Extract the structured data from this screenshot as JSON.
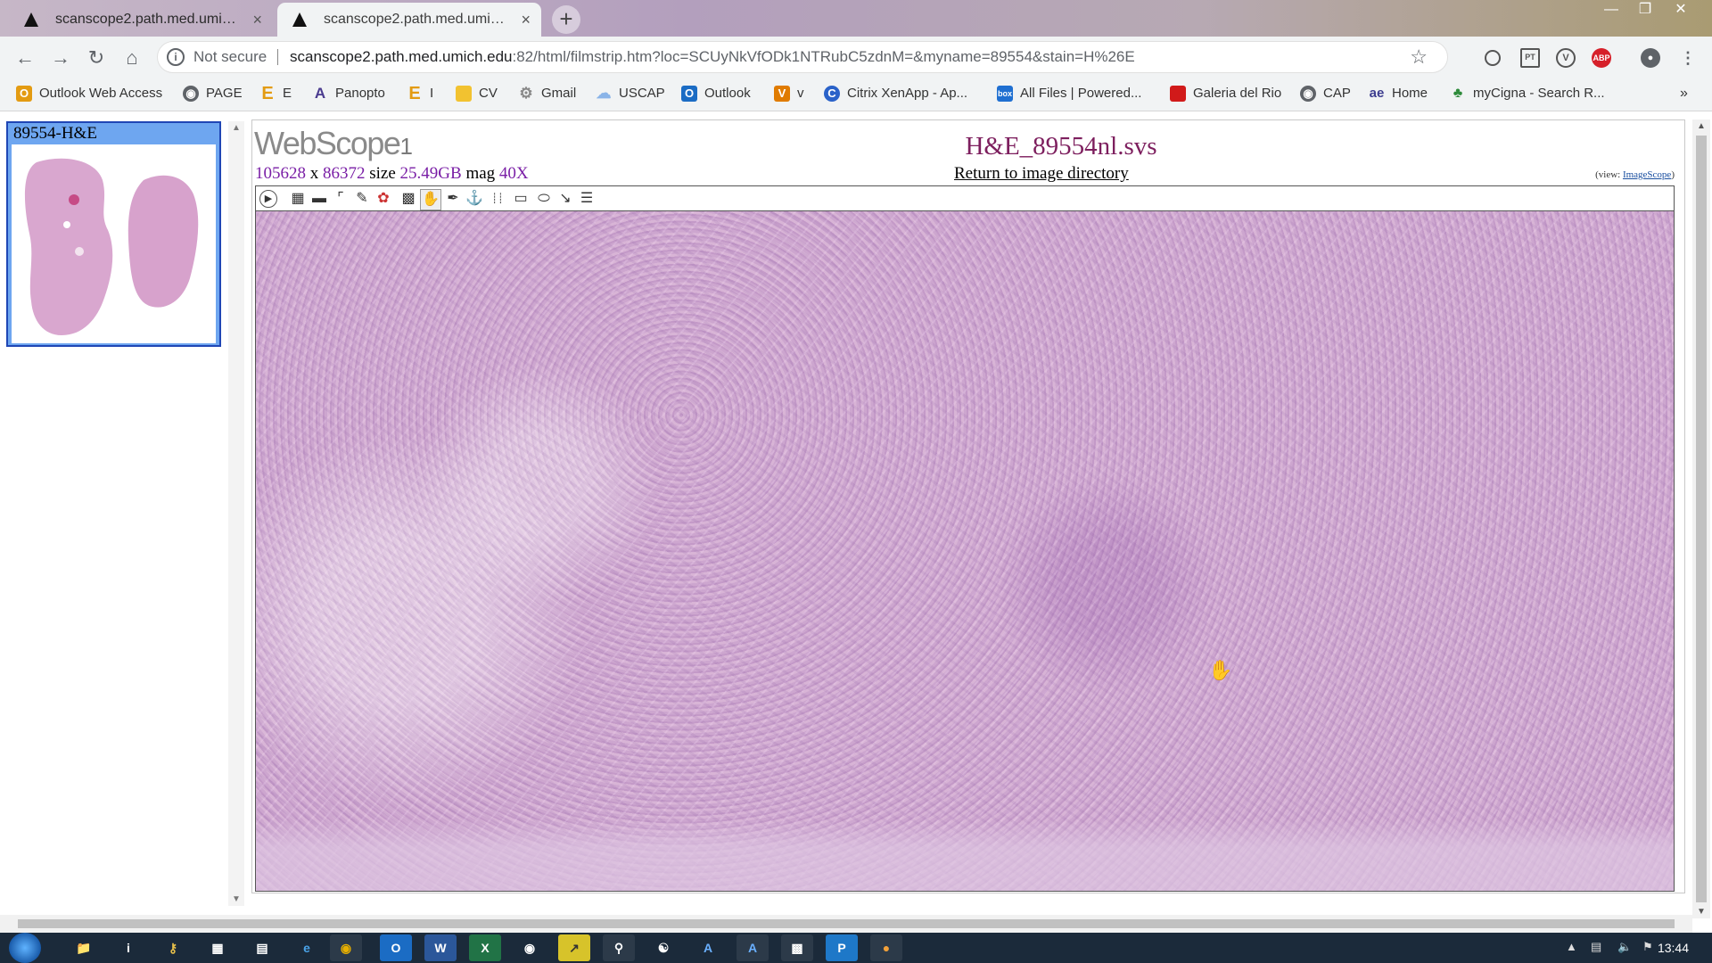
{
  "browser": {
    "tabs": [
      {
        "label": "scanscope2.path.med.umich.edu",
        "active": false
      },
      {
        "label": "scanscope2.path.med.umich.edu",
        "active": true
      }
    ],
    "new_tab": "+",
    "close_glyph": "×",
    "omnibox": {
      "security": "Not secure",
      "url_host": "scanscope2.path.med.umich.edu",
      "url_rest": ":82/html/filmstrip.htm?loc=SCUyNkVfODk1NTRubC5zdnM=&myname=89554&stain=H%26E"
    },
    "bookmarks": [
      {
        "label": "Outlook Web Access",
        "icon": "outlook-icon",
        "color": "#e39b12"
      },
      {
        "label": "PAGE",
        "icon": "globe-icon",
        "color": "#5f6368"
      },
      {
        "label": "E",
        "icon": "e-icon",
        "color": "#e39b12"
      },
      {
        "label": "Panopto",
        "icon": "panopto-icon",
        "color": "#4a3b8f"
      },
      {
        "label": "I",
        "icon": "e-icon",
        "color": "#e39b12"
      },
      {
        "label": "CV",
        "icon": "folder-icon",
        "color": "#f2c230"
      },
      {
        "label": "Gmail",
        "icon": "gear-icon",
        "color": "#888"
      },
      {
        "label": "USCAP",
        "icon": "cloud-icon",
        "color": "#8ab4e8"
      },
      {
        "label": "Outlook",
        "icon": "outlook-icon",
        "color": "#1b6cc4"
      },
      {
        "label": "v",
        "icon": "v-icon",
        "color": "#e07b00"
      },
      {
        "label": "Citrix XenApp - Ap...",
        "icon": "citrix-icon",
        "color": "#2a62c9"
      },
      {
        "label": "All Files | Powered...",
        "icon": "box-icon",
        "color": "#1f6fd1"
      },
      {
        "label": "Galeria del Rio",
        "icon": "square-icon",
        "color": "#d11a1a"
      },
      {
        "label": "CAP",
        "icon": "globe-icon",
        "color": "#5f6368"
      },
      {
        "label": "Home",
        "icon": "ae-icon",
        "color": "#3d3d8f"
      },
      {
        "label": "myCigna - Search R...",
        "icon": "tree-icon",
        "color": "#2d8a3a"
      }
    ]
  },
  "filmstrip": {
    "thumb_title": "89554-H&E"
  },
  "viewer": {
    "logo": "WebScope",
    "logo_version": "1",
    "width": "105628",
    "x_sep": "x",
    "height": "86372",
    "size_label": "size",
    "size": "25.49GB",
    "mag_label": "mag",
    "mag": "40X",
    "filename": "H&E_89554nl.svs",
    "return_link": "Return to image directory",
    "view_prefix": "(view: ",
    "view_link": "ImageScope",
    "view_suffix": ")"
  },
  "taskbar": {
    "clock": "13:44"
  }
}
